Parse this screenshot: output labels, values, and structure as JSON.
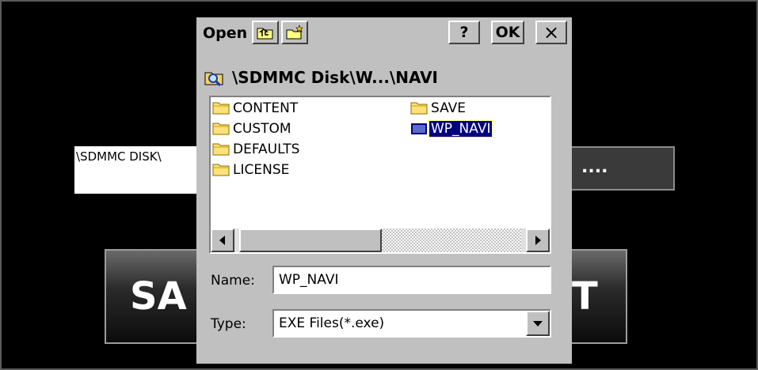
{
  "background": {
    "path_text": "\\SDMMC DISK\\",
    "browse_label": "....",
    "save_left": "SA",
    "save_right": "T"
  },
  "dialog": {
    "title": "Open",
    "help_label": "?",
    "ok_label": "OK",
    "close_label": "×",
    "path": "\\SDMMC Disk\\W...\\NAVI",
    "files": [
      {
        "label": "CONTENT",
        "icon": "folder-icon"
      },
      {
        "label": "CUSTOM",
        "icon": "folder-icon"
      },
      {
        "label": "DEFAULTS",
        "icon": "folder-icon"
      },
      {
        "label": "LICENSE",
        "icon": "folder-icon"
      },
      {
        "label": "SAVE",
        "icon": "folder-icon"
      },
      {
        "label": "WP_NAVI",
        "icon": "exe-file-icon",
        "selected": true
      }
    ],
    "name_label": "Name:",
    "name_value": "WP_NAVI",
    "type_label": "Type:",
    "type_value": "EXE Files(*.exe)"
  },
  "colors": {
    "dialog_bg": "#c0c0c0",
    "selection": "#000080",
    "screen_bg": "#000000"
  }
}
